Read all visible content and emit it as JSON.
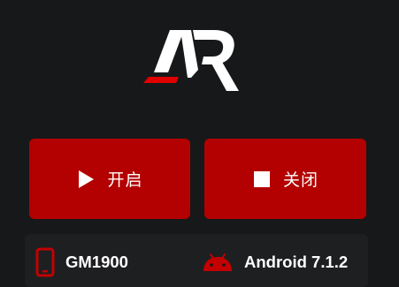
{
  "logo": {
    "text": "AR",
    "accent_color": "#e00000",
    "main_color": "#ffffff"
  },
  "controls": {
    "start": {
      "label": "开启",
      "icon": "play-icon"
    },
    "stop": {
      "label": "关闭",
      "icon": "stop-icon"
    },
    "button_color": "#b30000"
  },
  "device_info": {
    "model": "GM1900",
    "model_icon": "phone-icon",
    "os": "Android 7.1.2",
    "os_icon": "android-icon",
    "icon_color": "#c40000"
  }
}
